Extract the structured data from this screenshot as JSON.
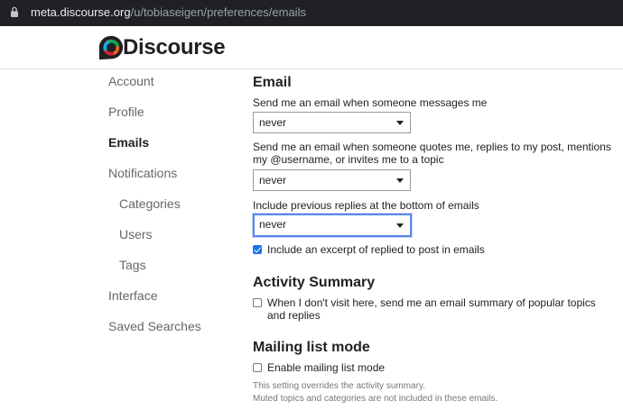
{
  "browser": {
    "url_host": "meta.discourse.org",
    "url_path": "/u/tobiaseigen/preferences/emails"
  },
  "header": {
    "logo_text": "Discourse"
  },
  "nav": {
    "items": [
      {
        "label": "Account"
      },
      {
        "label": "Profile"
      },
      {
        "label": "Emails"
      },
      {
        "label": "Notifications"
      },
      {
        "label": "Categories"
      },
      {
        "label": "Users"
      },
      {
        "label": "Tags"
      },
      {
        "label": "Interface"
      },
      {
        "label": "Saved Searches"
      }
    ],
    "active": "Emails"
  },
  "email": {
    "heading": "Email",
    "messages_label": "Send me an email when someone messages me",
    "messages_value": "never",
    "quotes_label_1": "Send me an email when someone quotes me, replies to my post, mentions",
    "quotes_label_2": "my @username, or invites me to a topic",
    "quotes_value": "never",
    "previous_replies_label": "Include previous replies at the bottom of emails",
    "previous_replies_value": "never",
    "excerpt_label": "Include an excerpt of replied to post in emails",
    "excerpt_checked": true
  },
  "activity": {
    "heading": "Activity Summary",
    "summary_label_1": "When I don't visit here, send me an email summary of popular topics",
    "summary_label_2": "and replies",
    "summary_checked": false
  },
  "mailing": {
    "heading": "Mailing list mode",
    "enable_label": "Enable mailing list mode",
    "enable_checked": false,
    "help_1": "This setting overrides the activity summary.",
    "help_2": "Muted topics and categories are not included in these emails."
  },
  "colors": {
    "accent": "#1a73e8",
    "focus_ring": "#5b86e5",
    "urlbar_bg": "#202124"
  }
}
